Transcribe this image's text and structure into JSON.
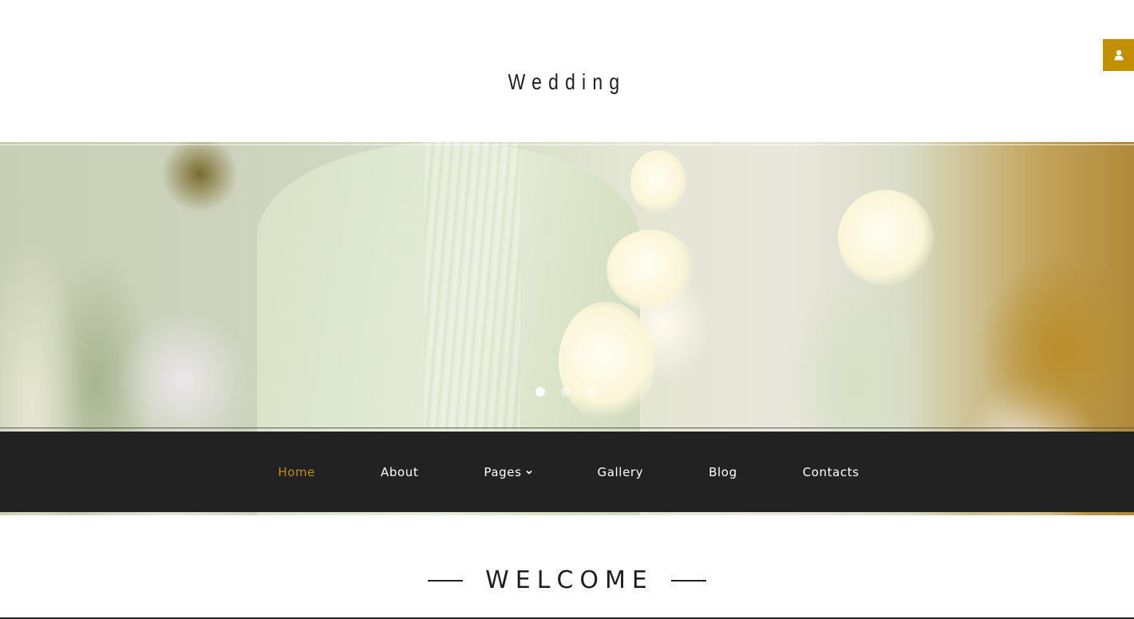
{
  "header": {
    "site_title": "Wedding",
    "user_button_icon": "user-icon",
    "accent_color": "#c28f00"
  },
  "hero": {
    "image_description": "Chairs draped in sage-green chiffon with white orchids",
    "slider": {
      "total_slides": 3,
      "active_slide": 1
    }
  },
  "nav": {
    "items": [
      {
        "label": "Home",
        "active": true
      },
      {
        "label": "About",
        "active": false
      },
      {
        "label": "Pages",
        "active": false,
        "has_dropdown": true
      },
      {
        "label": "Gallery",
        "active": false
      },
      {
        "label": "Blog",
        "active": false
      },
      {
        "label": "Contacts",
        "active": false
      }
    ],
    "background_color": "#222222",
    "active_color": "#c28f00"
  },
  "welcome": {
    "title": "WELCOME"
  }
}
